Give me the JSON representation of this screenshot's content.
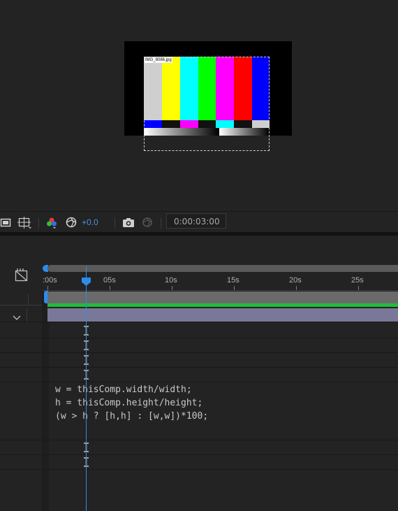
{
  "viewer": {
    "layer_label": "IMG_8086.jpg",
    "color_bars_top": [
      "#cfcfcf",
      "#ffff00",
      "#00ffff",
      "#00ff00",
      "#ff00ff",
      "#ff0000",
      "#0000ff"
    ],
    "color_bars_mid": [
      "#0000ff",
      "#000000",
      "#ff00ff",
      "#000000",
      "#00ffff",
      "#000000",
      "#cfcfcf"
    ]
  },
  "viewer_toolbar": {
    "exposure": "+0.0",
    "timecode": "0:00:03:00",
    "accent_color": "#4d8fe0"
  },
  "timeline": {
    "ruler_labels": [
      ":00s",
      "05s",
      "10s",
      "15s",
      "20s",
      "25s"
    ],
    "playhead_color": "#2d8ceb",
    "expression_lines": [
      "w = thisComp.width/width;",
      "h = thisComp.height/height;",
      "(w > h ? [h,h] : [w,w])*100;"
    ]
  }
}
